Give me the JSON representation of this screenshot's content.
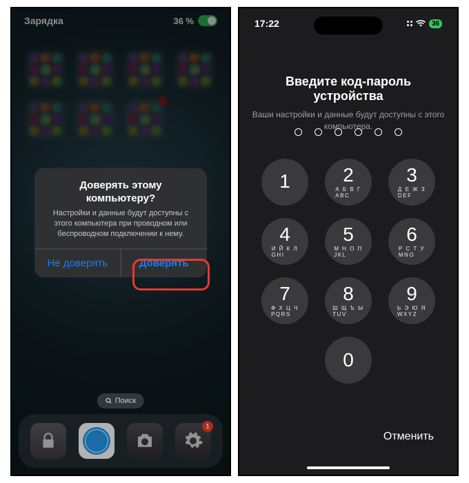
{
  "left": {
    "status": {
      "label": "Зарядка",
      "battery_pct": "36 %"
    },
    "search_label": "Поиск",
    "dock_badge": "1",
    "alert": {
      "title": "Доверять этому компьютеру?",
      "body": "Настройки и данные будут доступны с этого компьютера при проводном или беспроводном подключении к нему.",
      "btn_no": "Не доверять",
      "btn_yes": "Доверять"
    }
  },
  "right": {
    "status": {
      "time": "17:22",
      "battery_label": "36"
    },
    "title": "Введите код-пароль устройства",
    "subtitle": "Ваши настройки и данные будут доступны с этого компьютера.",
    "pin_length": 6,
    "keypad": [
      {
        "num": "1",
        "letters": ""
      },
      {
        "num": "2",
        "letters": "А Б В Г\nABC"
      },
      {
        "num": "3",
        "letters": "Д Е Ж З\nDEF"
      },
      {
        "num": "4",
        "letters": "И Й К Л\nGHI"
      },
      {
        "num": "5",
        "letters": "М Н О П\nJKL"
      },
      {
        "num": "6",
        "letters": "Р С Т У\nMNO"
      },
      {
        "num": "7",
        "letters": "Ф Х Ц Ч\nPQRS"
      },
      {
        "num": "8",
        "letters": "Ш Щ Ъ Ы\nTUV"
      },
      {
        "num": "9",
        "letters": "Ь Э Ю Я\nWXYZ"
      },
      {
        "num": "0",
        "letters": ""
      }
    ],
    "cancel": "Отменить"
  }
}
